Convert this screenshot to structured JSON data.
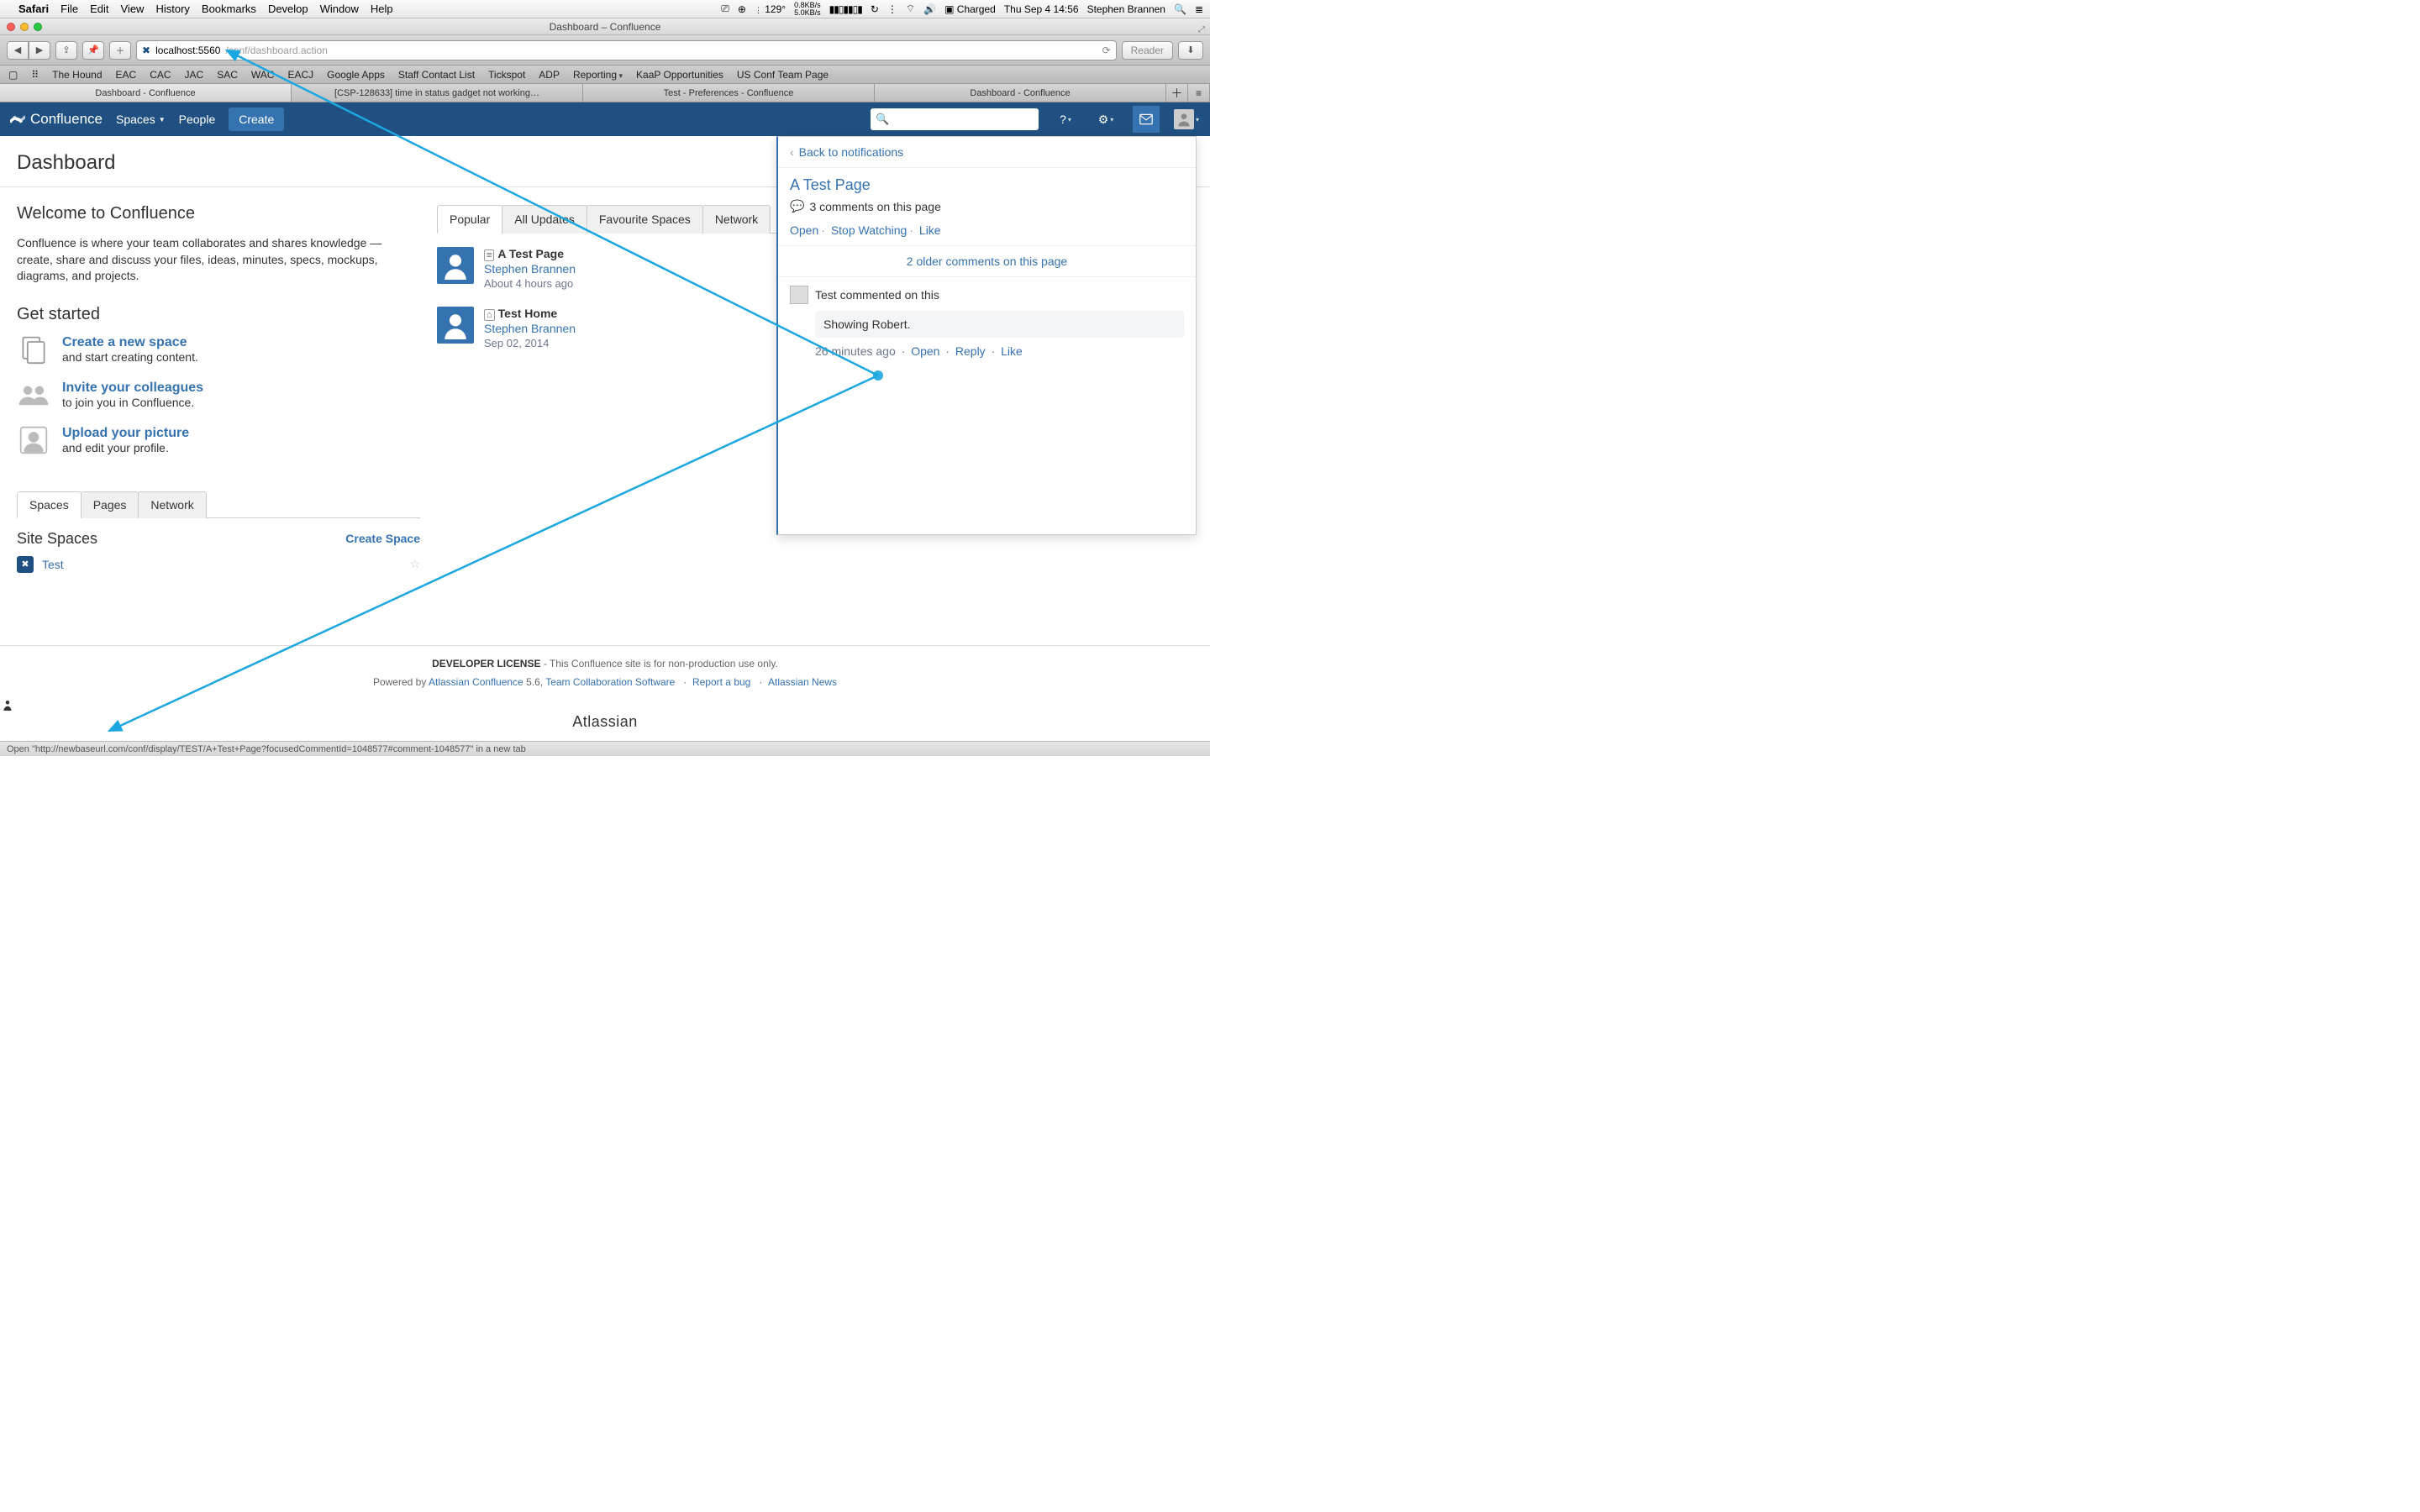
{
  "menubar": {
    "app": "Safari",
    "items": [
      "File",
      "Edit",
      "View",
      "History",
      "Bookmarks",
      "Develop",
      "Window",
      "Help"
    ],
    "temp": "129°",
    "net_up": "0.8KB/s",
    "net_dn": "5.0KB/s",
    "battery": "Charged",
    "datetime": "Thu Sep 4 14:56",
    "user": "Stephen Brannen"
  },
  "window_title": "Dashboard – Confluence",
  "address": {
    "host": "localhost:5560",
    "path": "/conf/dashboard.action",
    "reader": "Reader"
  },
  "bookmarks": [
    "The Hound",
    "EAC",
    "CAC",
    "JAC",
    "SAC",
    "WAC",
    "EACJ",
    "Google Apps",
    "Staff Contact List",
    "Tickspot",
    "ADP",
    "Reporting",
    "KaaP Opportunities",
    "US Conf Team Page"
  ],
  "bookmark_dropdowns": [
    "Reporting"
  ],
  "browser_tabs": [
    {
      "label": "Dashboard - Confluence",
      "active": true
    },
    {
      "label": "[CSP-128633] time in status gadget not working…",
      "active": false
    },
    {
      "label": "Test - Preferences - Confluence",
      "active": false
    },
    {
      "label": "Dashboard - Confluence",
      "active": false
    }
  ],
  "confluence_nav": {
    "brand": "Confluence",
    "spaces": "Spaces",
    "people": "People",
    "create": "Create"
  },
  "dashboard": {
    "title": "Dashboard",
    "welcome_h": "Welcome to Confluence",
    "welcome_p": "Confluence is where your team collaborates and shares knowledge — create, share and discuss your files, ideas, minutes, specs, mockups, diagrams, and projects.",
    "get_started_h": "Get started",
    "gs": [
      {
        "link": "Create a new space",
        "sub": "and start creating content."
      },
      {
        "link": "Invite your colleagues",
        "sub": "to join you in Confluence."
      },
      {
        "link": "Upload your picture",
        "sub": "and edit your profile."
      }
    ],
    "feed_tabs": [
      "Popular",
      "All Updates",
      "Favourite Spaces",
      "Network"
    ],
    "feed": [
      {
        "title": "A Test Page",
        "author": "Stephen Brannen",
        "time": "About 4 hours ago",
        "icon": "≡"
      },
      {
        "title": "Test Home",
        "author": "Stephen Brannen",
        "time": "Sep 02, 2014",
        "icon": "⌂"
      }
    ],
    "lower_tabs": [
      "Spaces",
      "Pages",
      "Network"
    ],
    "site_spaces_h": "Site Spaces",
    "create_space": "Create Space",
    "spaces": [
      {
        "name": "Test"
      }
    ]
  },
  "notif": {
    "back": "Back to notifications",
    "title": "A Test Page",
    "comments_count": "3 comments on this page",
    "open": "Open",
    "stop": "Stop Watching",
    "like": "Like",
    "older": "2 older comments on this page",
    "comment_head": "Test commented on this",
    "comment_body": "Showing Robert.",
    "comment_time": "26 minutes ago",
    "c_open": "Open",
    "c_reply": "Reply",
    "c_like": "Like"
  },
  "footer": {
    "license_bold": "DEVELOPER LICENSE",
    "license_rest": " - This Confluence site is for non-production use only.",
    "powered_pre": "Powered by ",
    "powered_link": "Atlassian Confluence",
    "powered_ver": " 5.6, ",
    "team": "Team Collaboration Software",
    "bug": "Report a bug",
    "news": "Atlassian News",
    "logo": "Atlassian"
  },
  "statusbar": "Open \"http://newbaseurl.com/conf/display/TEST/A+Test+Page?focusedCommentId=1048577#comment-1048577\" in a new tab"
}
